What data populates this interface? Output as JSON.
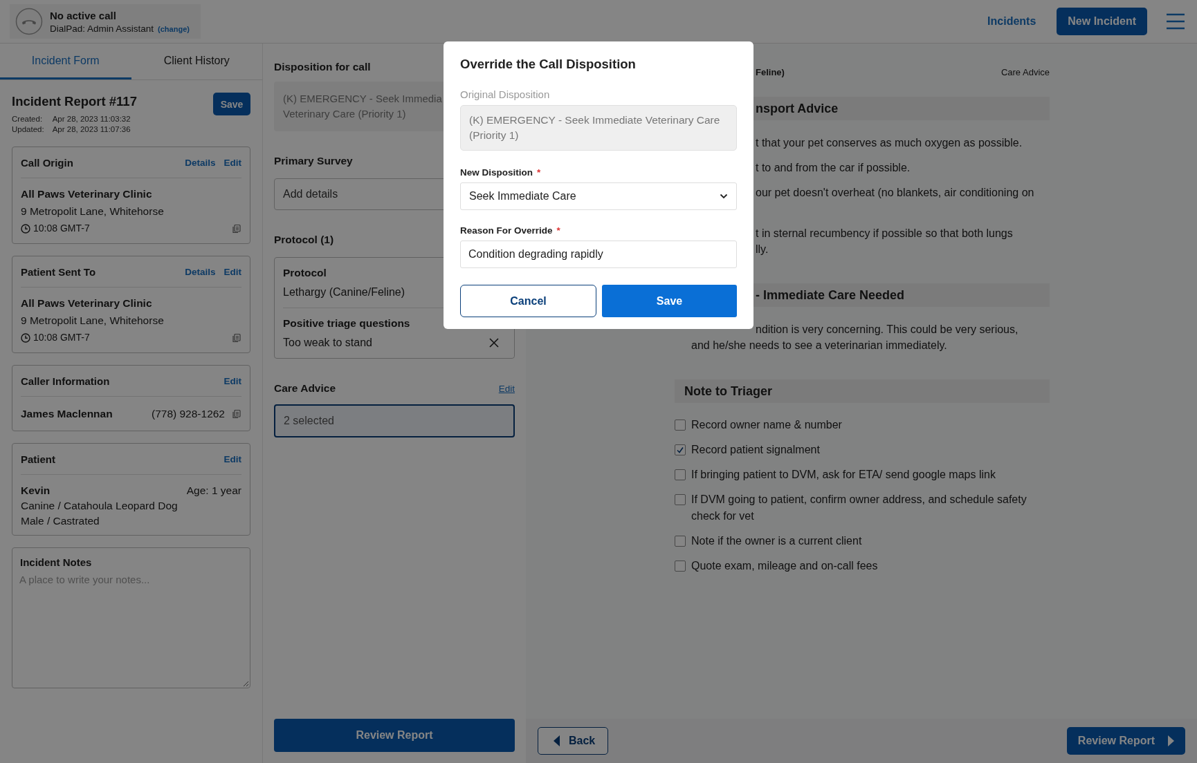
{
  "header": {
    "call_status": "No active call",
    "dialpad": "DialPad: Admin Assistant",
    "change_link": "(change)",
    "nav_link": "Incidents",
    "new_incident": "New Incident"
  },
  "tabs": [
    {
      "label": "Incident Form",
      "selected": true
    },
    {
      "label": "Client History",
      "selected": false
    }
  ],
  "report": {
    "title": "Incident Report #117",
    "save": "Save",
    "created_label": "Created:",
    "created": "Apr 28, 2023 11:03:32",
    "updated_label": "Updated:",
    "updated": "Apr 28, 2023 11:07:36"
  },
  "cards": [
    {
      "kind": "location",
      "title": "Call Origin",
      "actions": [
        "Details",
        "Edit"
      ],
      "name": "All Paws Veterinary Clinic",
      "address": "9 Metropolit Lane, Whitehorse",
      "time": "10:08 GMT-7"
    },
    {
      "kind": "location",
      "title": "Patient Sent To",
      "actions": [
        "Details",
        "Edit"
      ],
      "name": "All Paws Veterinary Clinic",
      "address": "9 Metropolit Lane, Whitehorse",
      "time": "10:08 GMT-7"
    },
    {
      "kind": "caller",
      "title": "Caller Information",
      "actions": [
        "Edit"
      ],
      "name": "James Maclennan",
      "phone": "(778) 928-1262"
    },
    {
      "kind": "patient",
      "title": "Patient",
      "actions": [
        "Edit"
      ],
      "name": "Kevin",
      "age": "Age: 1 year",
      "lines": [
        "Canine / Catahoula Leopard Dog",
        "Male / Castrated"
      ]
    }
  ],
  "notes": {
    "label": "Incident Notes",
    "placeholder": "A place to write your notes..."
  },
  "middle": {
    "disposition": {
      "label": "Disposition for call",
      "lines": [
        "(K) EMERGENCY - Seek Immedia",
        "Veterinary Care (Priority 1)"
      ]
    },
    "primary_survey": {
      "label": "Primary Survey",
      "value": "Add details"
    },
    "protocol": {
      "label": "Protocol (1)",
      "protocol_label": "Protocol",
      "protocol_value": "Lethargy (Canine/Feline)",
      "questions_label": "Positive triage questions",
      "questions_value": "Too weak to stand"
    },
    "care_advice": {
      "label": "Care Advice",
      "edit": "Edit",
      "value": "2 selected"
    },
    "review": "Review Report"
  },
  "right": {
    "protocol_title": "Feline)",
    "breadcrumb": "Care Advice",
    "sections": [
      {
        "title": "nsport Advice",
        "items": [
          {
            "lines": [
              "t that your pet conserves as much oxygen as possible."
            ]
          },
          {
            "lines": [
              "t to and from the car if possible."
            ]
          },
          {
            "lines": [
              "our pet doesn't overheat (no blankets, air conditioning on"
            ]
          },
          {
            "lines": [
              "t in sternal recumbency if possible so that both lungs",
              "lly."
            ]
          }
        ]
      },
      {
        "title": "- Immediate Care Needed",
        "items": [
          {
            "lines": [
              "ndition is very concerning. This could be very serious,",
              "and he/she needs to see a veterinarian immediately."
            ]
          }
        ]
      }
    ],
    "note": {
      "title": "Note to Triager",
      "checklist": [
        {
          "label": "Record owner name & number",
          "checked": false
        },
        {
          "label": "Record patient signalment",
          "checked": true
        },
        {
          "label": "If bringing patient to DVM, ask for ETA/ send google maps link",
          "checked": false
        },
        {
          "label": "If DVM going to patient, confirm owner address, and schedule safety check for vet",
          "checked": false
        },
        {
          "label": "Note if the owner is a current client",
          "checked": false
        },
        {
          "label": "Quote exam, mileage and on-call fees",
          "checked": false
        }
      ]
    },
    "back": "Back",
    "review": "Review Report"
  },
  "modal": {
    "title": "Override the Call Disposition",
    "original_label": "Original Disposition",
    "original_value": "(K) EMERGENCY - Seek Immediate Veterinary Care (Priority 1)",
    "new_label": "New Disposition",
    "new_required_mark": "*",
    "new_value": "Seek Immediate Care",
    "reason_label": "Reason For Override",
    "reason_required_mark": "*",
    "reason_value": "Condition degrading rapidly",
    "cancel": "Cancel",
    "save": "Save"
  }
}
